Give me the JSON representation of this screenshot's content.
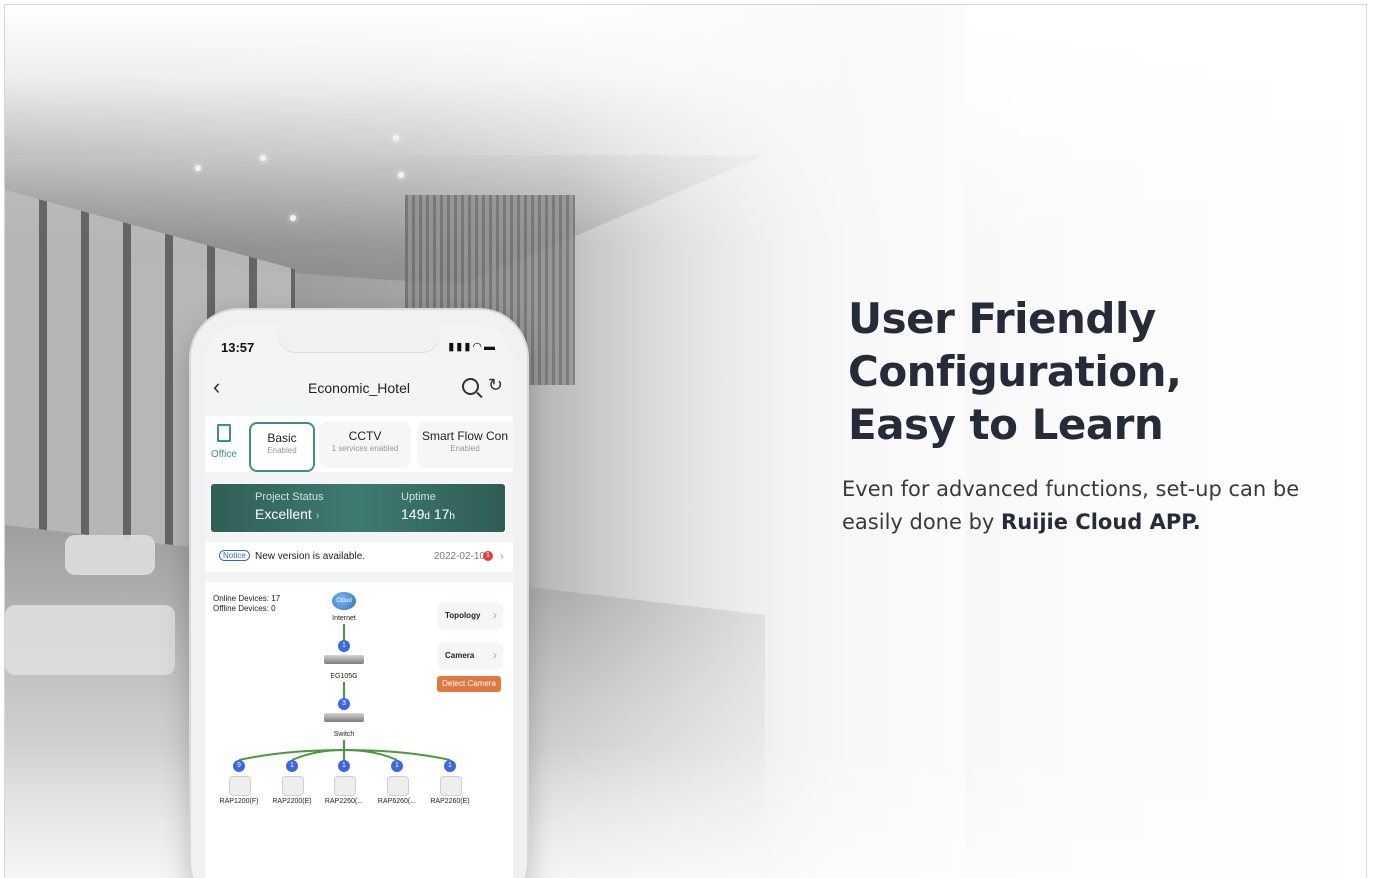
{
  "headline": {
    "line1": "User Friendly",
    "line2": "Configuration,",
    "line3": "Easy to Learn"
  },
  "subtext": {
    "line1": "Even for advanced functions, set-up can be",
    "line2_prefix": "easily done by ",
    "line2_bold": "Ruijie Cloud APP."
  },
  "phone": {
    "status_bar": {
      "time": "13:57",
      "icons": "signal-icon wifi-icon battery-icon"
    },
    "header": {
      "title": "Economic_Hotel",
      "icons": [
        "back-icon",
        "search-icon",
        "refresh-icon"
      ]
    },
    "scope": {
      "label": "Office",
      "icon": "building-icon"
    },
    "tabs": [
      {
        "title": "Basic",
        "subtitle": "Enabled",
        "active": true
      },
      {
        "title": "CCTV",
        "subtitle": "1 services enabled",
        "active": false
      },
      {
        "title": "Smart Flow Con",
        "subtitle": "Enabled",
        "active": false
      }
    ],
    "project_status": {
      "status_label": "Project Status",
      "status_value": "Excellent",
      "uptime_label": "Uptime",
      "uptime_days": "149",
      "uptime_days_unit": "d",
      "uptime_hours": "17",
      "uptime_hours_unit": "h"
    },
    "notice": {
      "badge": "Notice",
      "text": "New version is available.",
      "date": "2022-02-10",
      "count": "1"
    },
    "topology": {
      "online_devices": "Online Devices: 17",
      "offline_devices": "Offline Devices: 0",
      "topology_button": "Topology",
      "camera_button": "Camera",
      "detect_camera_button": "Detect Camera",
      "cloud_label": "Cloud",
      "internet_label": "Internet",
      "gateway_count": "1",
      "gateway_label": "EG105G",
      "switch_count": "3",
      "switch_label": "Switch",
      "access_points": [
        {
          "label": "RAP1200(F)",
          "count": "9"
        },
        {
          "label": "RAP2200(E)",
          "count": "1"
        },
        {
          "label": "RAP2260(...",
          "count": "1"
        },
        {
          "label": "RAP6260(...",
          "count": "1"
        },
        {
          "label": "RAP2260(E)",
          "count": "1"
        }
      ]
    }
  },
  "colors": {
    "headline": "#262b3a",
    "accent_teal": "#3f8d8c",
    "status_banner": "#3f7a70",
    "detect_button": "#e0783f",
    "count_badge": "#3d66e0",
    "topology_line": "#4a9a3c"
  }
}
